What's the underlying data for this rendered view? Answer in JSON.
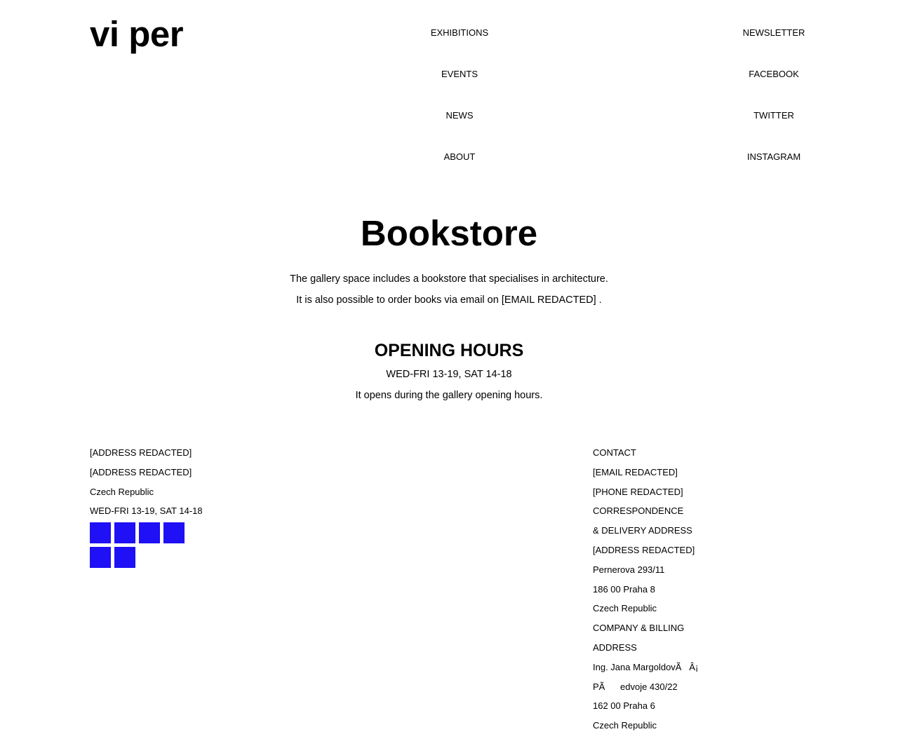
{
  "site": {
    "logo": "vi per"
  },
  "nav": {
    "main": [
      "EXHIBITIONS",
      "EVENTS",
      "NEWS",
      "ABOUT"
    ],
    "social": [
      "NEWSLETTER",
      "FACEBOOK",
      "TWITTER",
      "INSTAGRAM"
    ]
  },
  "content": {
    "title": "Bookstore",
    "intro_1": "The gallery space includes a bookstore that specialises in architecture.",
    "intro_2": "It is also possible to order books via email on [EMAIL REDACTED] .",
    "hours_heading": "OPENING HOURS",
    "hours": "WED-FRI 13-19, SAT 14-18",
    "hours_note": "It opens during the gallery opening hours."
  },
  "footer": {
    "left": [
      "[ADDRESS REDACTED]",
      "[ADDRESS REDACTED]",
      "Czech Republic",
      "WED-FRI 13-19, SAT 14-18"
    ],
    "square_color": "#1f10f5",
    "square_count": 6,
    "right": [
      "CONTACT",
      "[EMAIL REDACTED]",
      "[PHONE REDACTED]",
      "CORRESPONDENCE",
      "& DELIVERY ADDRESS",
      "[ADDRESS REDACTED]",
      "Pernerova 293/11",
      "186 00 Praha 8",
      "Czech Republic",
      "COMPANY & BILLING",
      "ADDRESS",
      "Ing. Jana MargoldovÃ   Â¡",
      "PÃ      edvoje 430/22",
      "162 00 Praha 6",
      "Czech Republic"
    ]
  }
}
